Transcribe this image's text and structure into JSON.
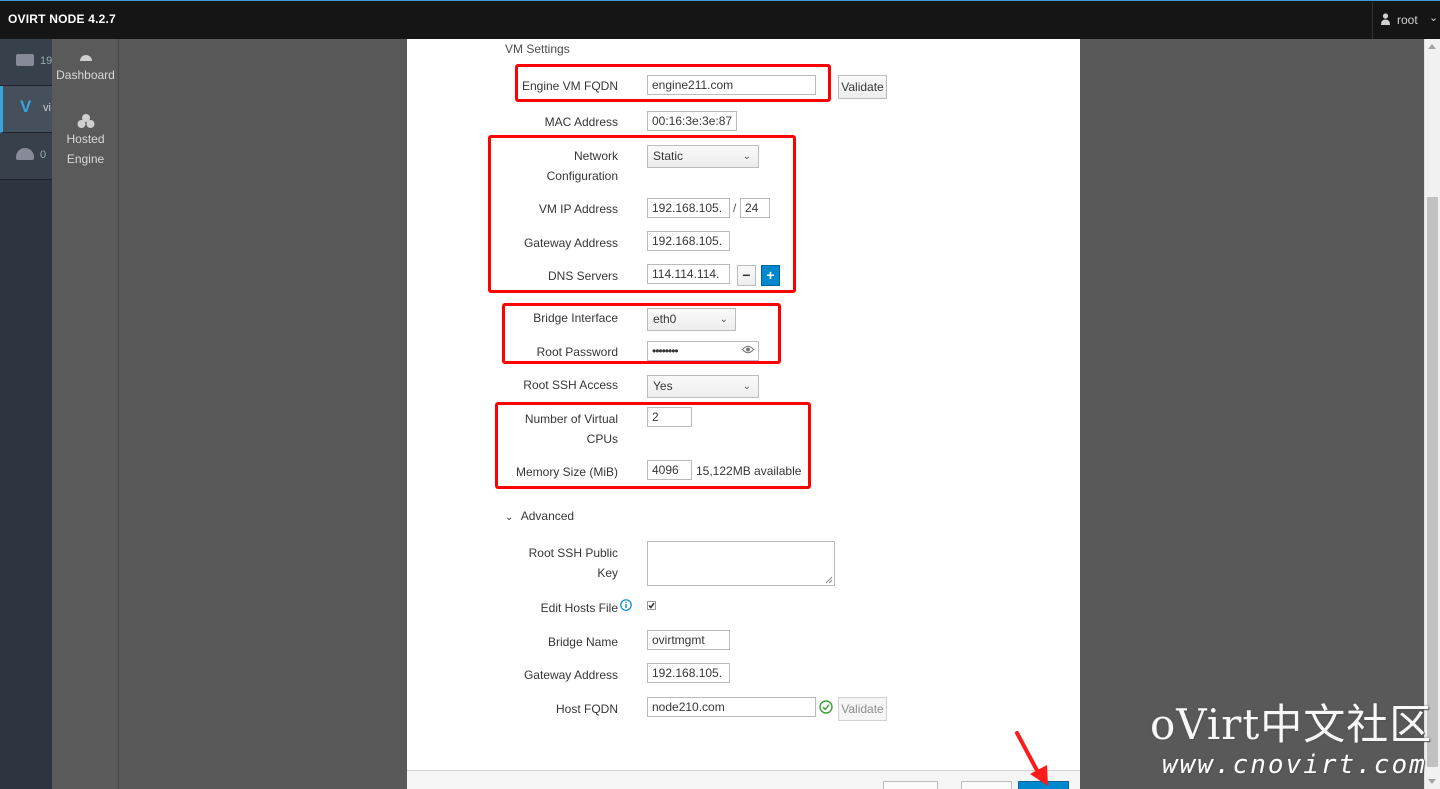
{
  "header": {
    "brand": "OVIRT NODE 4.2.7",
    "user": "root"
  },
  "nav": {
    "items": [
      {
        "letter": "",
        "text": "19"
      },
      {
        "letter": "V",
        "text": "vi"
      },
      {
        "letter": "",
        "text": "0"
      }
    ]
  },
  "subnav": {
    "dashboard": "Dashboard",
    "hosted_engine_line1": "Hosted",
    "hosted_engine_line2": "Engine"
  },
  "form": {
    "section_title": "VM Settings",
    "engine_fqdn": {
      "label": "Engine VM FQDN",
      "value": "engine211.com",
      "validate": "Validate"
    },
    "mac": {
      "label": "MAC Address",
      "value": "00:16:3e:3e:87"
    },
    "network_config": {
      "label_line1": "Network",
      "label_line2": "Configuration",
      "value": "Static"
    },
    "vm_ip": {
      "label": "VM IP Address",
      "value": "192.168.105.",
      "separator": "/",
      "prefix": "24"
    },
    "gateway": {
      "label": "Gateway Address",
      "value": "192.168.105."
    },
    "dns": {
      "label": "DNS Servers",
      "value": "114.114.114.",
      "minus": "−",
      "plus": "+"
    },
    "bridge_interface": {
      "label": "Bridge Interface",
      "value": "eth0"
    },
    "root_password": {
      "label": "Root Password",
      "value": "••••••••"
    },
    "root_ssh_access": {
      "label": "Root SSH Access",
      "value": "Yes"
    },
    "vcpus": {
      "label_line1": "Number of Virtual",
      "label_line2": "CPUs",
      "value": "2"
    },
    "memory": {
      "label": "Memory Size (MiB)",
      "value": "4096",
      "available": "15,122MB available"
    },
    "advanced": {
      "label": "Advanced"
    },
    "root_ssh_key": {
      "label_line1": "Root SSH Public",
      "label_line2": "Key",
      "value": ""
    },
    "edit_hosts": {
      "label": "Edit Hosts File",
      "checked": true
    },
    "bridge_name": {
      "label": "Bridge Name",
      "value": "ovirtmgmt"
    },
    "gateway2": {
      "label": "Gateway Address",
      "value": "192.168.105."
    },
    "host_fqdn": {
      "label": "Host FQDN",
      "value": "node210.com",
      "validate": "Validate"
    }
  },
  "watermark": {
    "text": "oVirt中文社区",
    "url": "www.cnovirt.com"
  },
  "colors": {
    "highlight": "#ff0000",
    "primary": "#0088ce",
    "topbar": "#151515"
  }
}
